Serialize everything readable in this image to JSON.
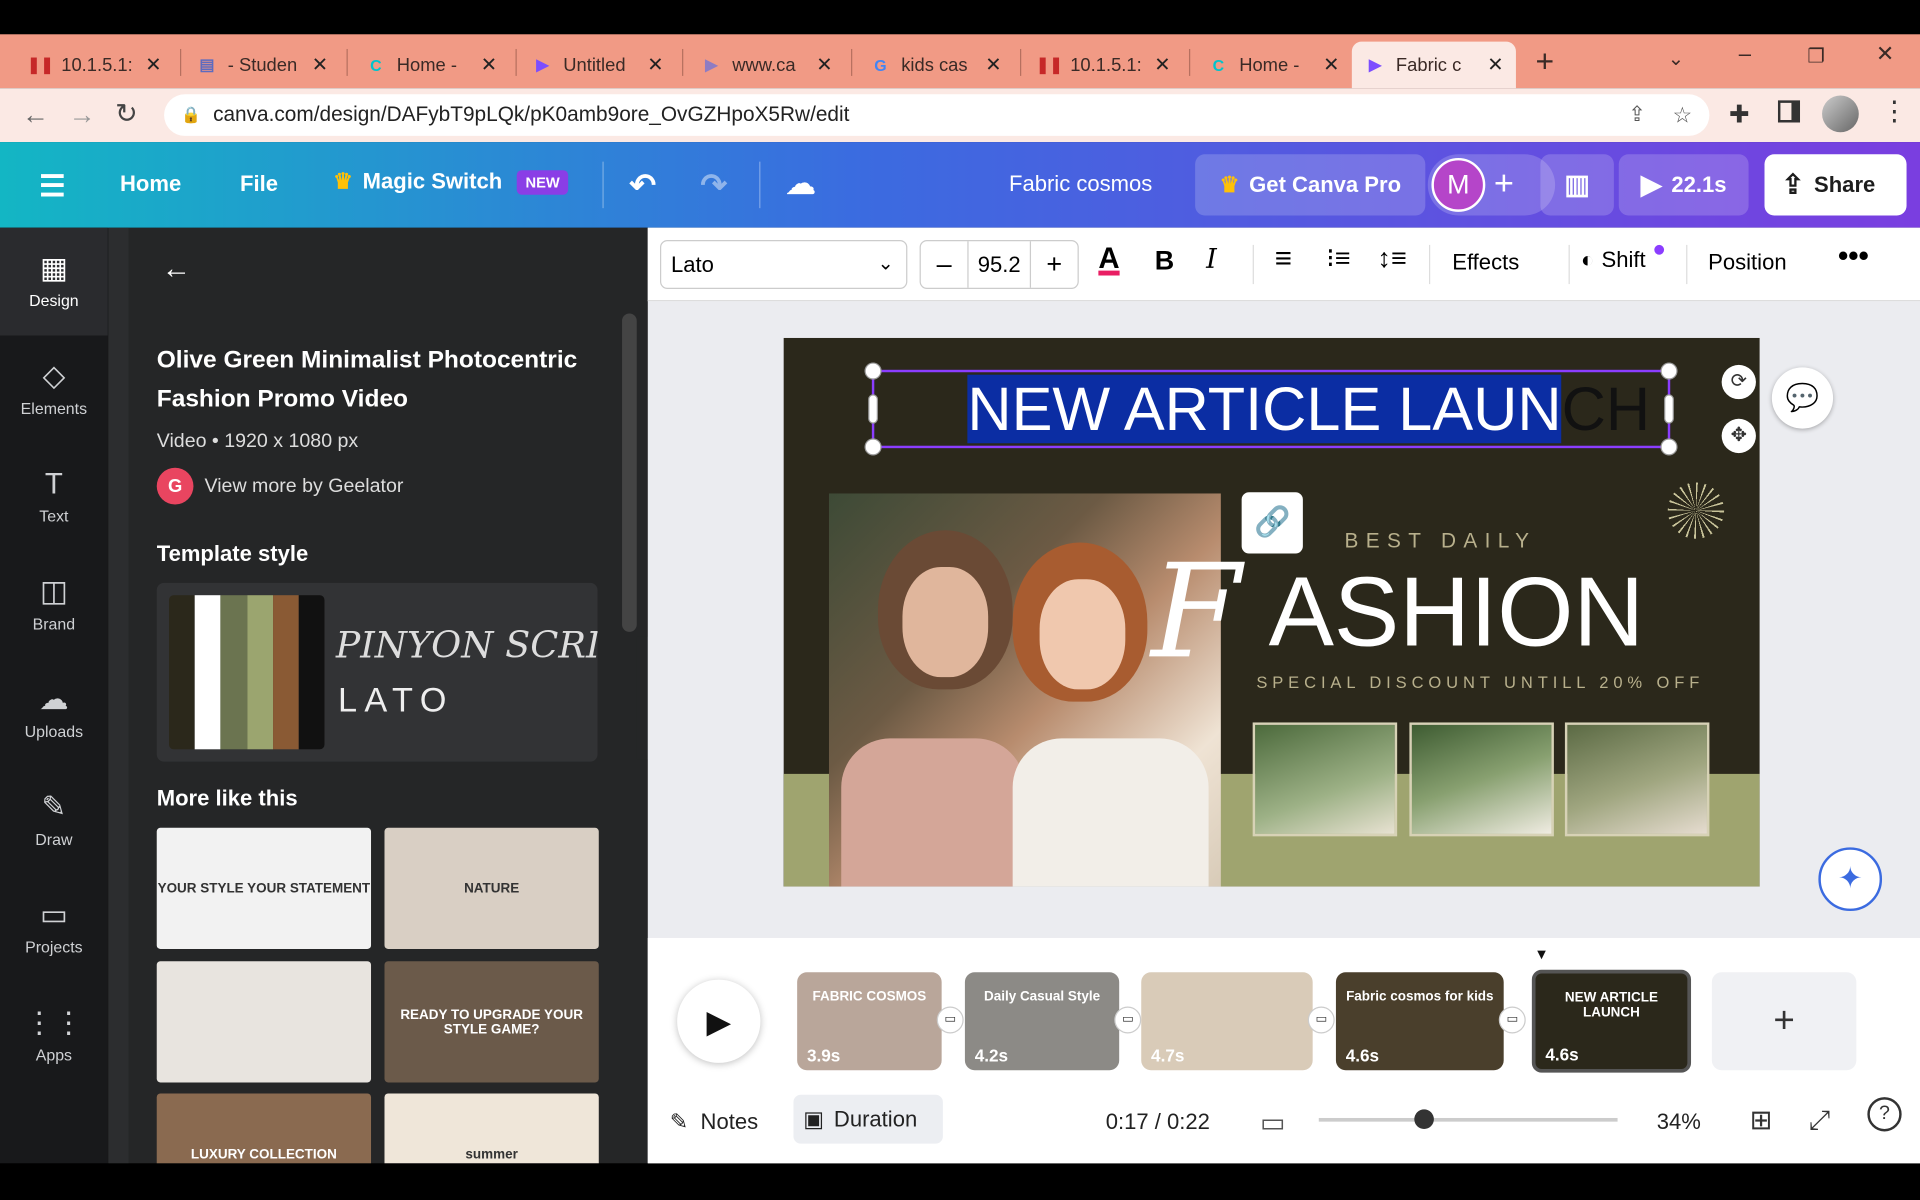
{
  "browser": {
    "tabs": [
      {
        "title": "10.1.5.1:",
        "icon": "pause-bars-icon",
        "color": "#c62828"
      },
      {
        "title": "- Studen",
        "icon": "book-icon",
        "color": "#5d6bc0"
      },
      {
        "title": "Home -",
        "icon": "canva-icon",
        "color": "#00c4cc"
      },
      {
        "title": "Untitled",
        "icon": "video-icon",
        "color": "#7c4dff"
      },
      {
        "title": "www.ca",
        "icon": "play-icon",
        "color": "#8e7cc3"
      },
      {
        "title": "kids cas",
        "icon": "google-icon",
        "color": "#4285f4"
      },
      {
        "title": "10.1.5.1:",
        "icon": "pause-bars-icon",
        "color": "#c62828"
      },
      {
        "title": "Home -",
        "icon": "canva-icon",
        "color": "#00c4cc"
      },
      {
        "title": "Fabric c",
        "icon": "video-icon",
        "color": "#7c4dff"
      }
    ],
    "url": "canva.com/design/DAFybT9pLQk/pK0amb9ore_OvGZHpoX5Rw/edit"
  },
  "header": {
    "home": "Home",
    "file": "File",
    "magic_switch": "Magic Switch",
    "new_badge": "NEW",
    "doc_title": "Fabric cosmos",
    "get_pro": "Get Canva Pro",
    "avatar": "M",
    "play_time": "22.1s",
    "share": "Share"
  },
  "rail": [
    {
      "label": "Design",
      "icon": "design-icon"
    },
    {
      "label": "Elements",
      "icon": "elements-icon"
    },
    {
      "label": "Text",
      "icon": "text-icon"
    },
    {
      "label": "Brand",
      "icon": "brand-icon"
    },
    {
      "label": "Uploads",
      "icon": "uploads-icon"
    },
    {
      "label": "Draw",
      "icon": "draw-icon"
    },
    {
      "label": "Projects",
      "icon": "projects-icon"
    },
    {
      "label": "Apps",
      "icon": "apps-icon"
    }
  ],
  "panel": {
    "title": "Olive Green Minimalist Photocentric Fashion Promo Video",
    "meta": "Video • 1920 x 1080 px",
    "author_initial": "G",
    "author": "View more by Geelator",
    "template_style": "Template style",
    "palette": [
      "#2b281b",
      "#ffffff",
      "#6b7450",
      "#9ba56f",
      "#8a5a34",
      "#111111"
    ],
    "font_script": "PINYON SCRI",
    "font_sans": "LATO",
    "more_like": "More like this",
    "thumbs": [
      {
        "text": "YOUR STYLE YOUR STATEMENT",
        "bg": "#f2f2f2"
      },
      {
        "text": "NATURE",
        "bg": "#d9cfc4"
      },
      {
        "text": "",
        "bg": "#e8e4df"
      },
      {
        "text": "READY TO UPGRADE YOUR STYLE GAME?",
        "bg": "#6b5a4a"
      },
      {
        "text": "LUXURY COLLECTION",
        "bg": "#8a6a50"
      },
      {
        "text": "summer",
        "bg": "#efe6d9"
      }
    ]
  },
  "toolbar": {
    "font": "Lato",
    "size": "95.2",
    "effects": "Effects",
    "shift": "Shift",
    "position": "Position"
  },
  "design": {
    "headline_selected": "NEW ARTICLE LAUN",
    "headline_rest": "CH",
    "best_daily": "BEST DAILY",
    "fashion_f": "F",
    "fashion_rest": "ASHION",
    "discount": "SPECIAL DISCOUNT UNTILL 20% OFF"
  },
  "timeline": {
    "scenes": [
      {
        "duration": "3.9s",
        "text": "FABRIC COSMOS",
        "bg": "#b9a69a"
      },
      {
        "duration": "4.2s",
        "text": "Daily Casual Style",
        "bg": "#8c8a86"
      },
      {
        "duration": "4.7s",
        "text": "",
        "bg": "#d9cbb8"
      },
      {
        "duration": "4.6s",
        "text": "Fabric cosmos for kids",
        "bg": "#4a3f2c"
      },
      {
        "duration": "4.6s",
        "text": "NEW ARTICLE LAUNCH",
        "bg": "#2b281b"
      }
    ],
    "notes": "Notes",
    "duration": "Duration",
    "time": "0:17 / 0:22",
    "zoom": "34%",
    "zoom_level": 0.34
  }
}
